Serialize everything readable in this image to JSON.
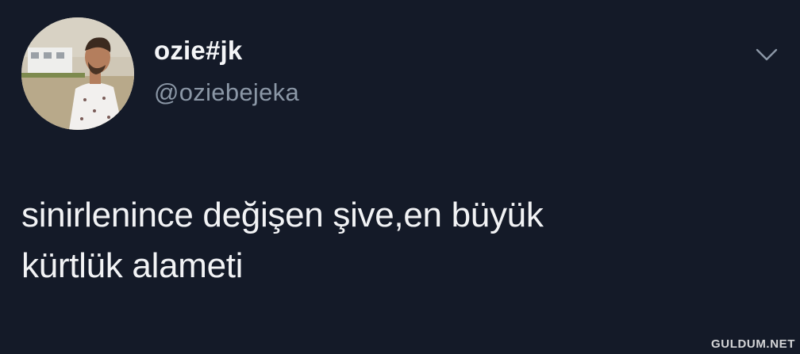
{
  "tweet": {
    "author": {
      "display_name": "ozie#jk",
      "handle": "@oziebejeka",
      "avatar_icon": "profile-photo"
    },
    "text_lines": [
      "sinirlenince değişen şive,en büyük",
      "kürtlük alameti"
    ],
    "menu_icon": "chevron-down-icon"
  },
  "watermark": "GULDUM.NET",
  "colors": {
    "background": "#141a28",
    "name": "#f4f5f7",
    "handle": "#8b97a6",
    "text": "#f2f3f5"
  }
}
